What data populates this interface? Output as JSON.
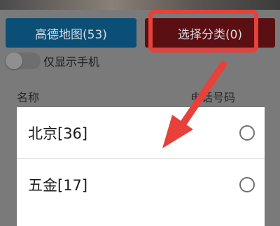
{
  "buttons": {
    "map_label": "高德地图(53)",
    "category_label": "选择分类(0)"
  },
  "toggle": {
    "label": "仅显示手机",
    "on": false
  },
  "columns": {
    "name": "名称",
    "phone": "电话号码"
  },
  "options": [
    {
      "label": "北京[36]",
      "selected": false
    },
    {
      "label": "五金[17]",
      "selected": false
    }
  ],
  "colors": {
    "map_button": "#0b4f76",
    "category_button": "#5a0f12",
    "annotation": "#e8403a"
  },
  "annotation": {
    "highlight": "highlight-box",
    "arrow": "arrow-pointing-to-first-option"
  }
}
